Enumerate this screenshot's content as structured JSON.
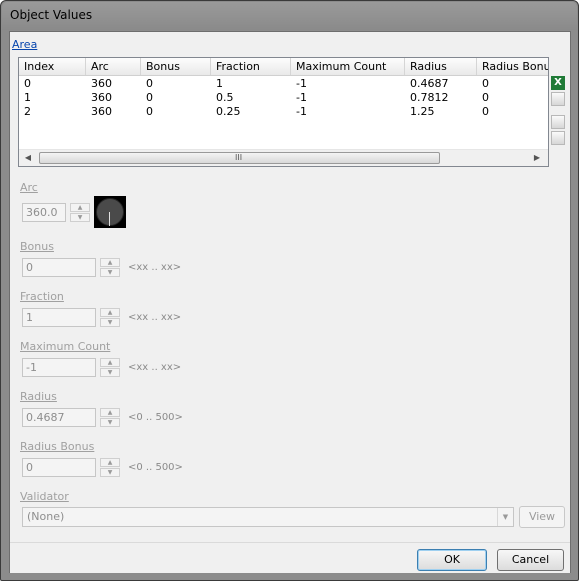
{
  "window": {
    "title": "Object Values"
  },
  "area_link": "Area",
  "table": {
    "columns": [
      "Index",
      "Arc",
      "Bonus",
      "Fraction",
      "Maximum Count",
      "Radius",
      "Radius Bonus"
    ],
    "rows": [
      [
        "0",
        "360",
        "0",
        "1",
        "-1",
        "0.4687",
        "0"
      ],
      [
        "1",
        "360",
        "0",
        "0.5",
        "-1",
        "0.7812",
        "0"
      ],
      [
        "2",
        "360",
        "0",
        "0.25",
        "-1",
        "1.25",
        "0"
      ]
    ]
  },
  "fields": {
    "arc": {
      "label": "Arc",
      "value": "360.0"
    },
    "bonus": {
      "label": "Bonus",
      "value": "0",
      "range": "<xx .. xx>"
    },
    "fraction": {
      "label": "Fraction",
      "value": "1",
      "range": "<xx .. xx>"
    },
    "maximum_count": {
      "label": "Maximum Count",
      "value": "-1",
      "range": "<xx .. xx>"
    },
    "radius": {
      "label": "Radius",
      "value": "0.4687",
      "range": "<0 .. 500>"
    },
    "radius_bonus": {
      "label": "Radius Bonus",
      "value": "0",
      "range": "<0 .. 500>"
    },
    "validator": {
      "label": "Validator",
      "value": "(None)",
      "view_label": "View"
    }
  },
  "buttons": {
    "ok": "OK",
    "cancel": "Cancel"
  },
  "scrollbar": {
    "grip": "III"
  },
  "icons": {
    "excel": "excel-export-icon"
  }
}
